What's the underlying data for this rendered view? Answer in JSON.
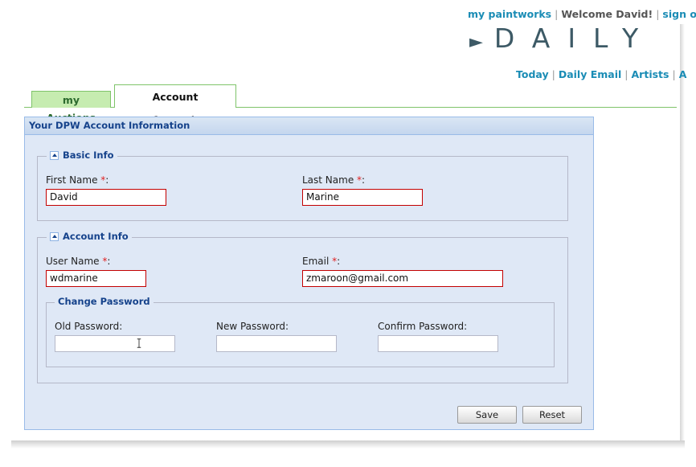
{
  "header": {
    "my_paintworks": "my paintworks",
    "welcome": "Welcome David!",
    "sign_out": "sign o",
    "brand": "DAILY",
    "brand_arrow": "►"
  },
  "subnav": {
    "today": "Today",
    "daily_email": "Daily Email",
    "artists": "Artists",
    "more": "A"
  },
  "tabs": [
    {
      "label": "my Auctions",
      "active": false
    },
    {
      "label": "Account Information",
      "active": true
    }
  ],
  "panel": {
    "title": "Your DPW Account Information",
    "basic_info": {
      "legend": "Basic Info",
      "first_name_label": "First Name ",
      "first_name_value": "David",
      "last_name_label": "Last Name ",
      "last_name_value": "Marine"
    },
    "account_info": {
      "legend": "Account Info",
      "user_name_label": "User Name ",
      "user_name_value": "wdmarine",
      "email_label": "Email ",
      "email_value": "zmaroon@gmail.com"
    },
    "change_password": {
      "legend": "Change Password",
      "old_label": "Old Password:",
      "new_label": "New Password:",
      "confirm_label": "Confirm Password:",
      "old_value": "",
      "new_value": "",
      "confirm_value": ""
    },
    "required_mark": "*",
    "colon": ":",
    "save_label": "Save",
    "reset_label": "Reset"
  },
  "colors": {
    "link": "#1a8cb5",
    "tab_green": "#7fc46a",
    "panel_bg": "#dfe8f6",
    "panel_title": "#15428b",
    "invalid_border": "#c30000"
  }
}
